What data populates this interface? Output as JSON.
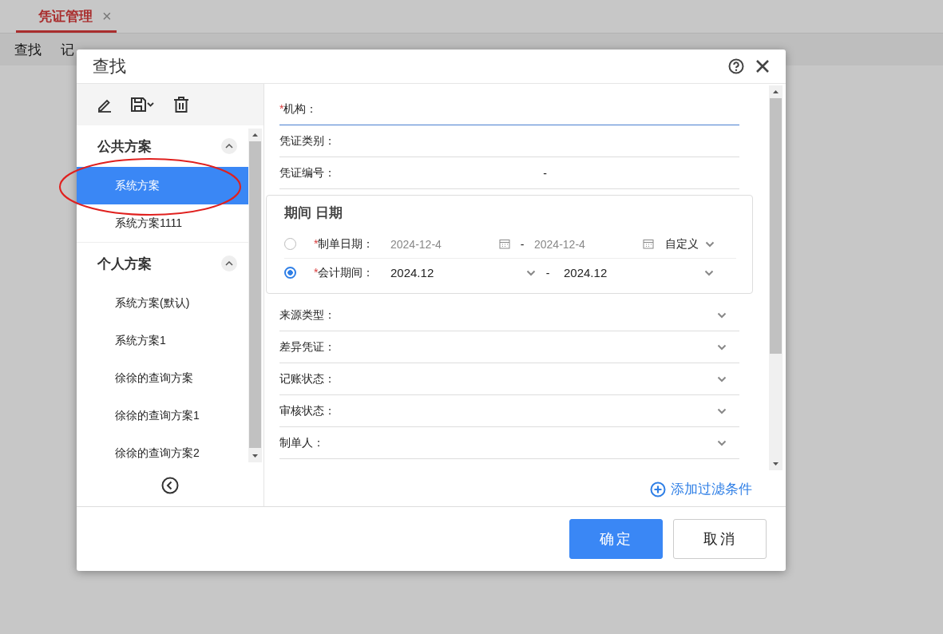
{
  "tabs": [
    {
      "label": "凭证管理",
      "selected": true,
      "close": "×"
    }
  ],
  "menu": [
    {
      "label": "查找"
    },
    {
      "label": "记"
    }
  ],
  "dialog": {
    "title": "查找",
    "schemes": [
      {
        "title": "公共方案",
        "expanded": true,
        "items": [
          {
            "label": "系统方案",
            "selected": true,
            "circled": true
          },
          {
            "label": "系统方案1111",
            "selected": false,
            "circled": false
          }
        ]
      },
      {
        "title": "个人方案",
        "expanded": true,
        "items": [
          {
            "label": "系统方案(默认)",
            "selected": false,
            "circled": false
          },
          {
            "label": "系统方案1",
            "selected": false,
            "circled": false
          },
          {
            "label": "徐徐的查询方案",
            "selected": false,
            "circled": false
          },
          {
            "label": "徐徐的查询方案1",
            "selected": false,
            "circled": false
          },
          {
            "label": "徐徐的查询方案2",
            "selected": false,
            "circled": false
          }
        ]
      }
    ],
    "fields_top": [
      {
        "kind": "text",
        "label": "机构：",
        "marker": "*",
        "focused": true
      },
      {
        "kind": "text",
        "label": "凭证类别：",
        "focused": false
      },
      {
        "kind": "range",
        "label": "凭证编号：",
        "focused": false,
        "separator": "-"
      }
    ],
    "period": {
      "title": "期间 日期",
      "rows": [
        {
          "kind": "date",
          "selected": false,
          "marker": "*",
          "label": "制单日期：",
          "from": "2024-12-4",
          "separator": "-",
          "to": "2024-12-4",
          "preset": "自定义"
        },
        {
          "kind": "period",
          "selected": true,
          "marker": "*",
          "label": "会计期间：",
          "from": "2024.12",
          "separator": "-",
          "to": "2024.12"
        }
      ]
    },
    "fields_bottom": [
      {
        "kind": "select",
        "label": "来源类型："
      },
      {
        "kind": "select",
        "label": "差异凭证："
      },
      {
        "kind": "select",
        "label": "记账状态："
      },
      {
        "kind": "select",
        "label": "审核状态："
      },
      {
        "kind": "select",
        "label": "制单人："
      }
    ],
    "add_filter": "添加过滤条件",
    "buttons": [
      {
        "label": "确定",
        "primary": true
      },
      {
        "label": "取消",
        "primary": false
      }
    ]
  }
}
